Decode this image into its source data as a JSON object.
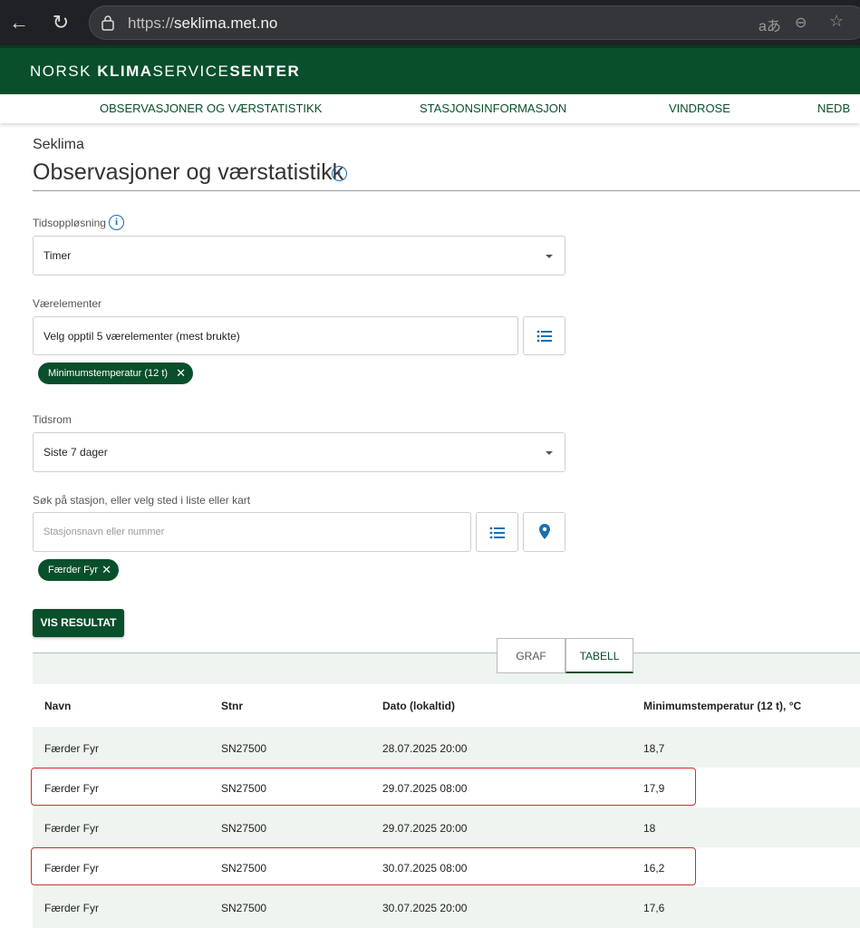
{
  "browser": {
    "url_prefix": "https://",
    "url_host": "seklima.met.no",
    "translate_icon": "aあ",
    "back_icon": "←",
    "reload_icon": "↻",
    "zoom_icon": "⊖",
    "star_icon": "☆"
  },
  "header": {
    "brand_part1": "NORSK ",
    "brand_part2": "KLIMA",
    "brand_part3": "SERVICE",
    "brand_part4": "SENTER"
  },
  "nav": {
    "items": [
      {
        "label": "OBSERVASJONER OG VÆRSTATISTIKK"
      },
      {
        "label": "STASJONSINFORMASJON"
      },
      {
        "label": "VINDROSE"
      },
      {
        "label": "NEDB"
      }
    ]
  },
  "page": {
    "breadcrumb": "Seklima",
    "title": "Observasjoner og værstatistikk",
    "info_glyph": "i"
  },
  "form": {
    "tidsopplosning": {
      "label": "Tidsoppløsning",
      "value": "Timer"
    },
    "verelementer": {
      "label": "Værelementer",
      "value": "Velg opptil 5 værelementer (mest brukte)",
      "chip": "Minimumstemperatur (12 t)"
    },
    "tidsrom": {
      "label": "Tidsrom",
      "value": "Siste 7 dager"
    },
    "stasjon": {
      "label": "Søk på stasjon, eller velg sted i liste eller kart",
      "placeholder": "Stasjonsnavn eller nummer",
      "chip": "Færder Fyr"
    },
    "submit_label": "VIS RESULTAT",
    "chip_close": "✕"
  },
  "tabs": [
    {
      "label": "GRAF",
      "active": false
    },
    {
      "label": "TABELL",
      "active": true
    }
  ],
  "table": {
    "headers": [
      "Navn",
      "Stnr",
      "Dato (lokaltid)",
      "Minimumstemperatur (12 t), °C"
    ],
    "rows": [
      [
        "Færder Fyr",
        "SN27500",
        "28.07.2025 20:00",
        "18,7"
      ],
      [
        "Færder Fyr",
        "SN27500",
        "29.07.2025 08:00",
        "17,9"
      ],
      [
        "Færder Fyr",
        "SN27500",
        "29.07.2025 20:00",
        "18"
      ],
      [
        "Færder Fyr",
        "SN27500",
        "30.07.2025 08:00",
        "16,2"
      ],
      [
        "Færder Fyr",
        "SN27500",
        "30.07.2025 20:00",
        "17,6"
      ]
    ]
  },
  "colors": {
    "brand_green": "#0a4f2c",
    "row_tint": "#eef4ef",
    "highlight_red": "#d22b2b",
    "info_blue": "#1a6fb0"
  }
}
